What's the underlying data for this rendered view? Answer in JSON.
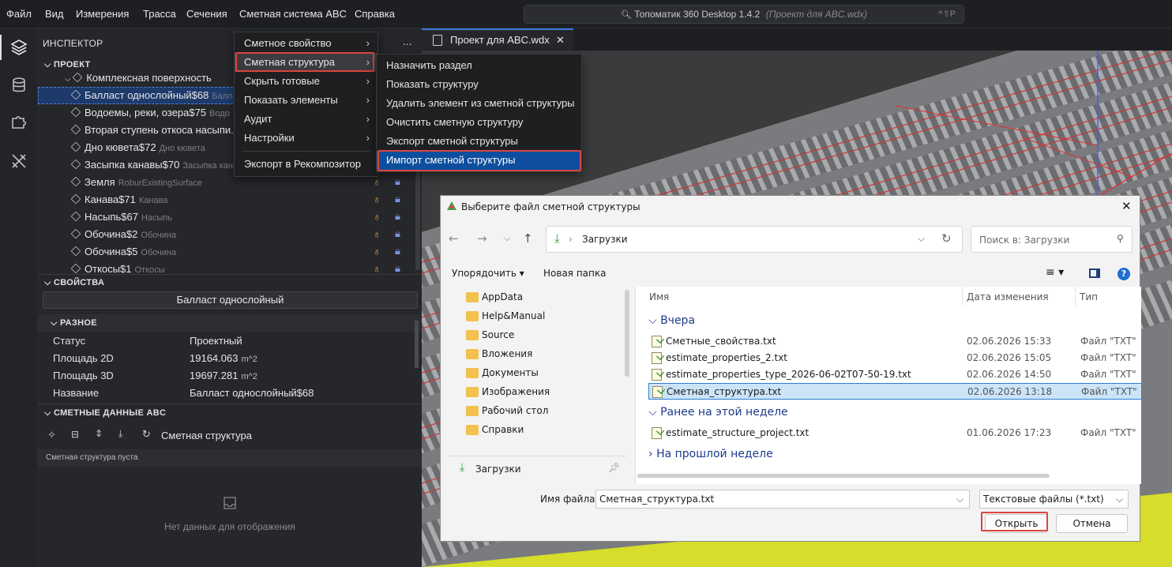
{
  "menubar": {
    "items": [
      "Файл",
      "Вид",
      "Измерения",
      "Трасса",
      "Сечения",
      "Сметная система ABC",
      "Справка"
    ],
    "search_title": "Топоматик 360 Desktop 1.4.2",
    "search_project": "(Проект для ABC.wdx)",
    "search_shortcut": "^⇧P"
  },
  "activity_bar": {
    "icons": [
      "layers-icon",
      "database-icon",
      "puzzle-icon",
      "tools-icon"
    ]
  },
  "inspector": {
    "title": "ИНСПЕКТОР",
    "more": "...",
    "project_header": "ПРОЕКТ",
    "complex_surface": "Комплексная поверхность",
    "tree_items": [
      {
        "name": "Балласт однослойный$68",
        "sub": "Балл",
        "selected": true,
        "icons": false
      },
      {
        "name": "Водоемы, реки, озера$75",
        "sub": "Водо",
        "selected": false,
        "icons": false
      },
      {
        "name": "Вторая ступень откоса насыпи.",
        "sub": "",
        "selected": false,
        "icons": false
      },
      {
        "name": "Дно кювета$72",
        "sub": "Дно кювета",
        "selected": false,
        "icons": false
      },
      {
        "name": "Засыпка канавы$70",
        "sub": "Засыпка кана",
        "selected": false,
        "icons": false
      },
      {
        "name": "Земля",
        "sub": "RoburExistingSurface",
        "selected": false,
        "icons": true
      },
      {
        "name": "Канава$71",
        "sub": "Канава",
        "selected": false,
        "icons": true
      },
      {
        "name": "Насыпь$67",
        "sub": "Насыпь",
        "selected": false,
        "icons": true
      },
      {
        "name": "Обочина$2",
        "sub": "Обочина",
        "selected": false,
        "icons": true
      },
      {
        "name": "Обочина$5",
        "sub": "Обочина",
        "selected": false,
        "icons": true
      },
      {
        "name": "Откосы$1",
        "sub": "Откосы",
        "selected": false,
        "icons": true
      }
    ],
    "properties_header": "СВОЙСТВА",
    "selected_object": "Балласт однослойный",
    "misc_header": "РАЗНОЕ",
    "properties": [
      {
        "label": "Статус",
        "value": "Проектный",
        "unit": ""
      },
      {
        "label": "Площадь 2D",
        "value": "19164.063",
        "unit": "m^2"
      },
      {
        "label": "Площадь 3D",
        "value": "19697.281",
        "unit": "m^2"
      },
      {
        "label": "Название",
        "value": "Балласт однослойный$68",
        "unit": ""
      }
    ],
    "estimate_header": "СМЕТНЫЕ ДАННЫЕ ABC",
    "estimate_toolbar_title": "Сметная структура",
    "estimate_empty_caption": "Сметная структура пуста",
    "no_data": "Нет данных для отображения"
  },
  "editor": {
    "tab_label": "Проект для ABC.wdx",
    "tab_close": "✕"
  },
  "context_menu": {
    "items": [
      {
        "label": "Сметное свойство",
        "submenu": true
      },
      {
        "label": "Сметная структура",
        "submenu": true,
        "highlighted": true
      },
      {
        "label": "Скрыть готовые",
        "submenu": true
      },
      {
        "label": "Показать элементы",
        "submenu": true
      },
      {
        "label": "Аудит",
        "submenu": true
      },
      {
        "label": "Настройки",
        "submenu": true
      },
      {
        "label": "Экспорт в Рекомпозитор",
        "submenu": false
      }
    ]
  },
  "submenu": {
    "items": [
      "Назначить раздел",
      "Показать структуру",
      "Удалить элемент из сметной структуры",
      "Очистить сметную структуру",
      "Экспорт сметной структуры",
      "Импорт сметной структуры"
    ],
    "active_index": 5
  },
  "file_dialog": {
    "title": "Выберите файл сметной структуры",
    "path": "Загрузки",
    "search_placeholder": "Поиск в: Загрузки",
    "organize": "Упорядочить ▾",
    "new_folder": "Новая папка",
    "nav_folders": [
      "AppData",
      "Help&Manual",
      "Source",
      "Вложения",
      "Документы",
      "Изображения",
      "Рабочий стол",
      "Справки"
    ],
    "quick_access": "Загрузки",
    "columns": {
      "name": "Имя",
      "date": "Дата изменения",
      "type": "Тип"
    },
    "groups": {
      "yesterday": "Вчера",
      "this_week": "Ранее на этой неделе",
      "last_week": "На прошлой неделе"
    },
    "files_yesterday": [
      {
        "name": "Сметные_свойства.txt",
        "date": "02.06.2026 15:33",
        "type": "Файл \"TXT\""
      },
      {
        "name": "estimate_properties_2.txt",
        "date": "02.06.2026 15:05",
        "type": "Файл \"TXT\""
      },
      {
        "name": "estimate_properties_type_2026-06-02T07-50-19.txt",
        "date": "02.06.2026 14:50",
        "type": "Файл \"TXT\""
      },
      {
        "name": "Сметная_структура.txt",
        "date": "02.06.2026 13:18",
        "type": "Файл \"TXT\""
      }
    ],
    "files_this_week": [
      {
        "name": "estimate_structure_project.txt",
        "date": "01.06.2026 17:23",
        "type": "Файл \"TXT\""
      }
    ],
    "filename_label": "Имя файла:",
    "filename_value": "Сметная_структура.txt",
    "filter_value": "Текстовые файлы (*.txt)",
    "open_button": "Открыть",
    "cancel_button": "Отмена"
  },
  "colors": {
    "accent": "#3c7be0",
    "highlight_red": "#d9463f",
    "menu_select": "#0d4f9e",
    "ground_yellow": "#d6dd2a"
  }
}
